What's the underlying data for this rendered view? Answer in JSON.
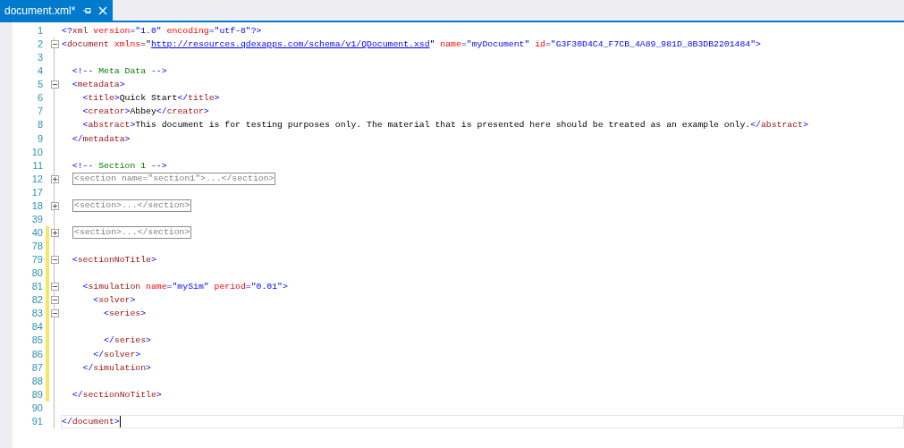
{
  "tab": {
    "title": "document.xml*",
    "selected": true
  },
  "lines": [
    {
      "number": "1",
      "changed": false,
      "current": false,
      "tokens": [
        {
          "kind": "punct",
          "text": "<?"
        },
        {
          "kind": "tag",
          "text": "xml"
        },
        {
          "kind": "attr",
          "text": " version"
        },
        {
          "kind": "punct",
          "text": "=\"1.0\""
        },
        {
          "kind": "attr",
          "text": " encoding"
        },
        {
          "kind": "punct",
          "text": "=\"utf-8\"?>"
        }
      ]
    },
    {
      "number": "2",
      "expanded": true,
      "changed": false,
      "current": false,
      "tokens": [
        {
          "kind": "punct",
          "text": "<"
        },
        {
          "kind": "tag",
          "text": "document"
        },
        {
          "kind": "attr",
          "text": " xmlns"
        },
        {
          "kind": "text",
          "text": "=\""
        },
        {
          "kind": "link",
          "text": "http://resources.qdexapps.com/schema/v1/QDocument.xsd"
        },
        {
          "kind": "text",
          "text": "\""
        },
        {
          "kind": "attr",
          "text": " name"
        },
        {
          "kind": "punct",
          "text": "=\"myDocument\""
        },
        {
          "kind": "attr",
          "text": " id"
        },
        {
          "kind": "punct",
          "text": "=\"G3F30D4C4_F7CB_4A89_981D_8B3DB2201484\">"
        }
      ]
    },
    {
      "number": "3",
      "changed": false,
      "current": false
    },
    {
      "number": "4",
      "changed": false,
      "current": false,
      "tokens": [
        {
          "kind": "punct",
          "text": "  <!--"
        },
        {
          "kind": "comment",
          "text": " Meta Data "
        },
        {
          "kind": "punct",
          "text": "-->"
        }
      ]
    },
    {
      "number": "5",
      "expanded": true,
      "changed": false,
      "current": false,
      "tokens": [
        {
          "kind": "punct",
          "text": "  <"
        },
        {
          "kind": "tag",
          "text": "metadata"
        },
        {
          "kind": "punct",
          "text": ">"
        }
      ]
    },
    {
      "number": "6",
      "changed": false,
      "current": false,
      "tokens": [
        {
          "kind": "punct",
          "text": "    <"
        },
        {
          "kind": "tag",
          "text": "title"
        },
        {
          "kind": "punct",
          "text": ">"
        },
        {
          "kind": "text",
          "text": "Quick Start"
        },
        {
          "kind": "punct",
          "text": "</"
        },
        {
          "kind": "tag",
          "text": "title"
        },
        {
          "kind": "punct",
          "text": ">"
        }
      ]
    },
    {
      "number": "7",
      "changed": false,
      "current": false,
      "tokens": [
        {
          "kind": "punct",
          "text": "    <"
        },
        {
          "kind": "tag",
          "text": "creator"
        },
        {
          "kind": "punct",
          "text": ">"
        },
        {
          "kind": "text",
          "text": "Abbey"
        },
        {
          "kind": "punct",
          "text": "</"
        },
        {
          "kind": "tag",
          "text": "creator"
        },
        {
          "kind": "punct",
          "text": ">"
        }
      ]
    },
    {
      "number": "8",
      "changed": false,
      "current": false,
      "tokens": [
        {
          "kind": "punct",
          "text": "    <"
        },
        {
          "kind": "tag",
          "text": "abstract"
        },
        {
          "kind": "punct",
          "text": ">"
        },
        {
          "kind": "text",
          "text": "This document is for testing purposes only. The material that is presented here should be treated as an example only."
        },
        {
          "kind": "punct",
          "text": "</"
        },
        {
          "kind": "tag",
          "text": "abstract"
        },
        {
          "kind": "punct",
          "text": ">"
        }
      ]
    },
    {
      "number": "9",
      "changed": false,
      "current": false,
      "tokens": [
        {
          "kind": "punct",
          "text": "  </"
        },
        {
          "kind": "tag",
          "text": "metadata"
        },
        {
          "kind": "punct",
          "text": ">"
        }
      ]
    },
    {
      "number": "10",
      "changed": false,
      "current": false
    },
    {
      "number": "11",
      "changed": false,
      "current": false,
      "tokens": [
        {
          "kind": "punct",
          "text": "  <!--"
        },
        {
          "kind": "comment",
          "text": " Section 1 "
        },
        {
          "kind": "punct",
          "text": "-->"
        }
      ]
    },
    {
      "number": "12",
      "expanded": false,
      "changed": false,
      "current": false,
      "tokens": [
        {
          "kind": "collapsed",
          "text": "<section name=\"section1\">...</section>"
        }
      ]
    },
    {
      "number": "17",
      "changed": false,
      "current": false
    },
    {
      "number": "18",
      "expanded": false,
      "changed": false,
      "current": false,
      "tokens": [
        {
          "kind": "collapsed",
          "text": "<section>...</section>"
        }
      ]
    },
    {
      "number": "39",
      "changed": false,
      "current": false
    },
    {
      "number": "40",
      "expanded": false,
      "changed": true,
      "current": false,
      "tokens": [
        {
          "kind": "collapsed",
          "text": "<section>...</section>"
        }
      ]
    },
    {
      "number": "78",
      "changed": true,
      "current": false
    },
    {
      "number": "79",
      "expanded": true,
      "changed": true,
      "current": false,
      "tokens": [
        {
          "kind": "punct",
          "text": "  <"
        },
        {
          "kind": "tag",
          "text": "sectionNoTitle"
        },
        {
          "kind": "punct",
          "text": ">"
        }
      ]
    },
    {
      "number": "80",
      "changed": true,
      "current": false
    },
    {
      "number": "81",
      "expanded": true,
      "changed": true,
      "current": false,
      "tokens": [
        {
          "kind": "punct",
          "text": "    <"
        },
        {
          "kind": "tag",
          "text": "simulation"
        },
        {
          "kind": "attr",
          "text": " name"
        },
        {
          "kind": "punct",
          "text": "=\"mySim\""
        },
        {
          "kind": "attr",
          "text": " period"
        },
        {
          "kind": "punct",
          "text": "=\"0.01\">"
        }
      ]
    },
    {
      "number": "82",
      "expanded": true,
      "changed": true,
      "current": false,
      "tokens": [
        {
          "kind": "punct",
          "text": "      <"
        },
        {
          "kind": "tag",
          "text": "solver"
        },
        {
          "kind": "punct",
          "text": ">"
        }
      ]
    },
    {
      "number": "83",
      "expanded": true,
      "changed": true,
      "current": false,
      "tokens": [
        {
          "kind": "punct",
          "text": "        <"
        },
        {
          "kind": "tag",
          "text": "series"
        },
        {
          "kind": "punct",
          "text": ">"
        }
      ]
    },
    {
      "number": "84",
      "changed": true,
      "current": false
    },
    {
      "number": "85",
      "changed": true,
      "current": false,
      "tokens": [
        {
          "kind": "punct",
          "text": "        </"
        },
        {
          "kind": "tag",
          "text": "series"
        },
        {
          "kind": "punct",
          "text": ">"
        }
      ]
    },
    {
      "number": "86",
      "changed": true,
      "current": false,
      "tokens": [
        {
          "kind": "punct",
          "text": "      </"
        },
        {
          "kind": "tag",
          "text": "solver"
        },
        {
          "kind": "punct",
          "text": ">"
        }
      ]
    },
    {
      "number": "87",
      "changed": true,
      "current": false,
      "tokens": [
        {
          "kind": "punct",
          "text": "    </"
        },
        {
          "kind": "tag",
          "text": "simulation"
        },
        {
          "kind": "punct",
          "text": ">"
        }
      ]
    },
    {
      "number": "88",
      "changed": true,
      "current": false
    },
    {
      "number": "89",
      "changed": true,
      "current": false,
      "tokens": [
        {
          "kind": "punct",
          "text": "  </"
        },
        {
          "kind": "tag",
          "text": "sectionNoTitle"
        },
        {
          "kind": "punct",
          "text": ">"
        }
      ]
    },
    {
      "number": "90",
      "changed": false,
      "current": false
    },
    {
      "number": "91",
      "changed": false,
      "current": true,
      "tokens": [
        {
          "kind": "punct",
          "text": "</"
        },
        {
          "kind": "tag",
          "text": "document"
        },
        {
          "kind": "punct",
          "text": ">"
        }
      ]
    }
  ]
}
